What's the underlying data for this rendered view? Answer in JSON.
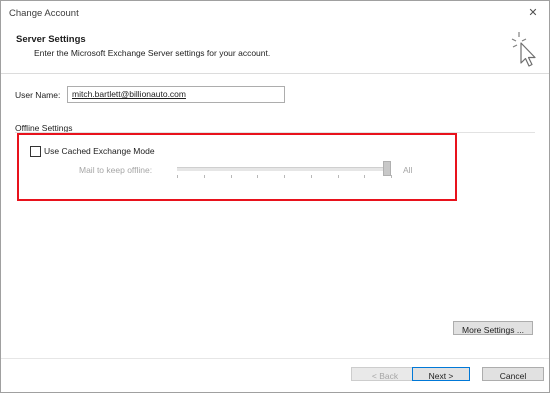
{
  "window": {
    "title": "Change Account"
  },
  "header": {
    "title": "Server Settings",
    "subtitle": "Enter the Microsoft Exchange Server settings for your account.",
    "icon": "cursor-click-icon"
  },
  "user": {
    "label": "User Name:",
    "value": "mitch.bartlett@billionauto.com"
  },
  "offline": {
    "section_label": "Offline Settings",
    "cached_mode_label": "Use Cached Exchange Mode",
    "cached_mode_checked": false,
    "slider_label": "Mail to keep offline:",
    "slider_value_label": "All",
    "slider_position_fraction": 1.0,
    "highlight_color": "#e8121c"
  },
  "buttons": {
    "more_settings": "More Settings ...",
    "back": "< Back",
    "next": "Next >",
    "cancel": "Cancel"
  }
}
